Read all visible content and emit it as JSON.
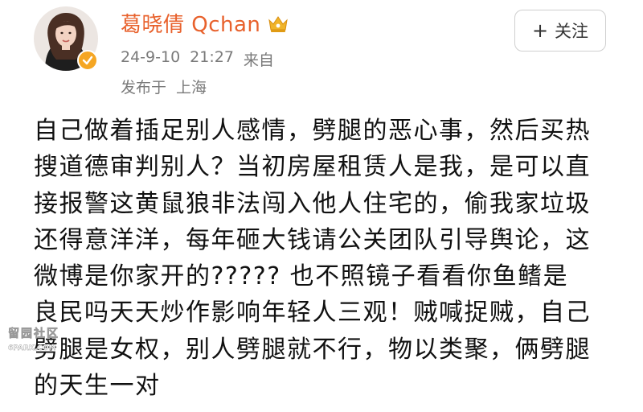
{
  "author": {
    "name": "葛晓倩 Qchan",
    "avatar_icon": "avatar-photo",
    "verified_icon": "vip-badge-icon",
    "name_badge_icon": "crown-icon",
    "name_color": "#e8612c"
  },
  "post_meta": {
    "date": "24-9-10",
    "time": "21:27",
    "source_prefix": "来自",
    "location_prefix": "发布于",
    "location": "上海"
  },
  "follow_button": {
    "icon": "plus-icon",
    "plus": "+",
    "label": "关注"
  },
  "post": {
    "lines": [
      "自己做着插足别人感情，劈腿的恶心事，然后买热",
      "搜道德审判别人？当初房屋租赁人是我，是可以直",
      "接报警这黄鼠狼非法闯入他人住宅的，偷我家垃圾",
      "还得意洋洋，每年砸大钱请公关团队引导舆论，这",
      "微博是你家开的?????  也不照镜子看看你鱼鳍是",
      "良民吗天天炒作影响年轻人三观！贼喊捉贼，自己",
      "劈腿是女权，别人劈腿就不行，物以类聚，俩劈腿",
      "的天生一对"
    ]
  },
  "watermark": {
    "chars": "留园社区",
    "domain": "6PARK.COM"
  }
}
